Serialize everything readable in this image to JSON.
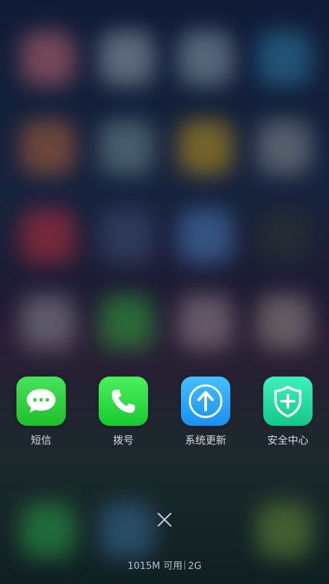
{
  "apps": [
    {
      "label": "短信",
      "icon": "message-bubble-icon"
    },
    {
      "label": "拨号",
      "icon": "phone-handset-icon"
    },
    {
      "label": "系统更新",
      "icon": "upload-arrow-icon"
    },
    {
      "label": "安全中心",
      "icon": "shield-plus-icon"
    }
  ],
  "close_icon": "close-icon",
  "memory": {
    "available": "1015M 可用",
    "total": "2G"
  },
  "colors": {
    "messages": "#35d63f",
    "phone": "#2ee64a",
    "update": "#29a8ff",
    "security": "#23e1a3"
  }
}
